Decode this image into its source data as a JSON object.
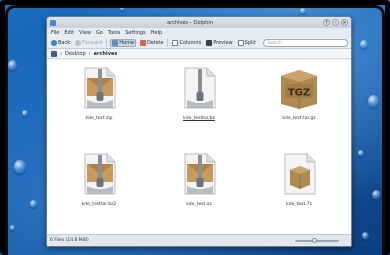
{
  "window": {
    "title": "archives – Dolphin",
    "controls": [
      "?",
      "–",
      "×"
    ]
  },
  "menu": [
    "File",
    "Edit",
    "View",
    "Go",
    "Tools",
    "Settings",
    "Help"
  ],
  "toolbar": {
    "back": "Back",
    "forward": "Forward",
    "home": "Home",
    "delete": "Delete",
    "columns": "Columns",
    "preview": "Preview",
    "split": "Split",
    "search_placeholder": "Search"
  },
  "breadcrumb": [
    "Desktop",
    "archives"
  ],
  "files": [
    {
      "name": "kde_test.zip",
      "icon": "zipper-archive-icon"
    },
    {
      "name": "kde_testtar.bz",
      "icon": "zipper-archive-icon"
    },
    {
      "name": "kde_test.tar.gz",
      "icon": "tgz-box-icon",
      "badge": "TGZ"
    },
    {
      "name": "kde_testtar.bz2",
      "icon": "zipper-archive-icon"
    },
    {
      "name": "kde_test.xz",
      "icon": "zipper-archive-icon"
    },
    {
      "name": "kde_test.7z",
      "icon": "box-file-icon"
    }
  ],
  "status": {
    "text": "6 Files (14,8 MiB)",
    "zoom_fraction": 0.45
  },
  "colors": {
    "wallpaper": "#1258a6",
    "tgz_box": "#b08a52"
  }
}
